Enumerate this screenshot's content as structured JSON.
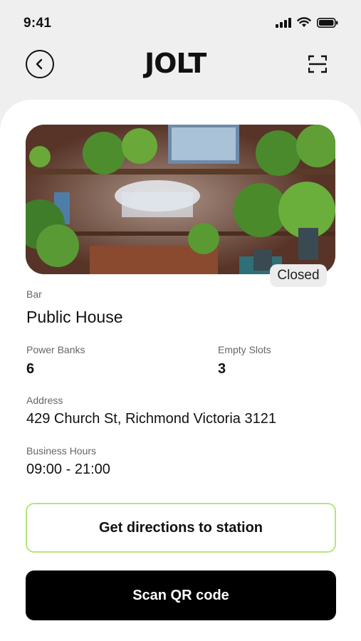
{
  "status": {
    "time": "9:41"
  },
  "header": {
    "logo": "JOLT",
    "back_icon": "chevron-left-icon",
    "scan_icon": "qr-scan-icon"
  },
  "station": {
    "photo_status": "Closed",
    "category": "Bar",
    "name": "Public House",
    "power_banks_label": "Power Banks",
    "power_banks_value": "6",
    "empty_slots_label": "Empty Slots",
    "empty_slots_value": "3",
    "address_label": "Address",
    "address_value": "429 Church St, Richmond Victoria 3121",
    "hours_label": "Business Hours",
    "hours_value": "09:00 - 21:00"
  },
  "actions": {
    "directions_label": "Get directions to station",
    "scan_label": "Scan QR code"
  },
  "colors": {
    "accent_green": "#b7e47a",
    "primary": "#000000"
  }
}
